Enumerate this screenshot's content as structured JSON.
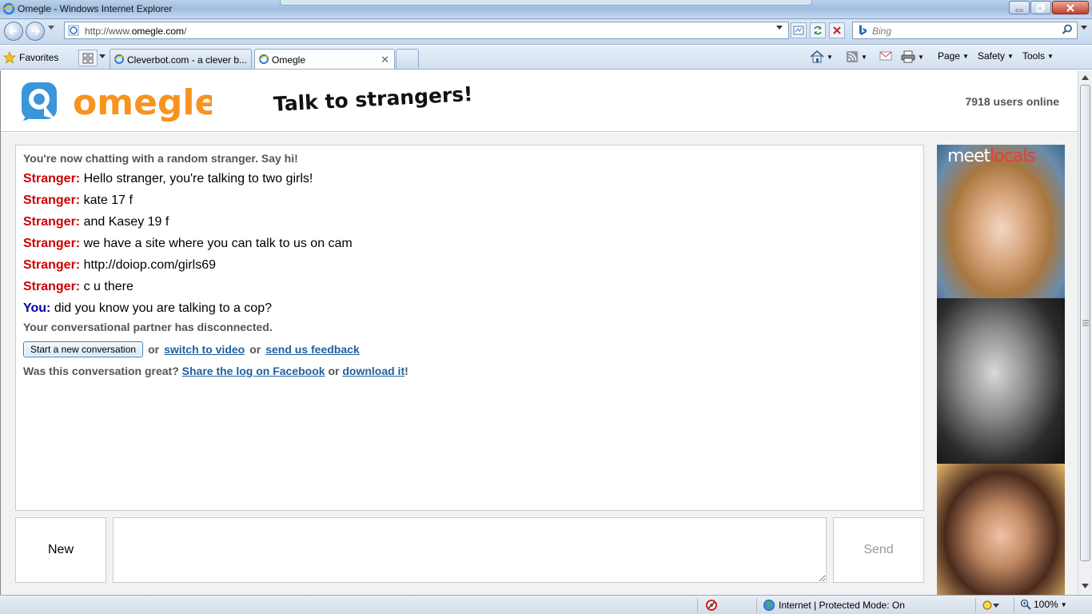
{
  "window": {
    "title": "Omegle - Windows Internet Explorer"
  },
  "address_bar": {
    "url_prefix": "http://www.",
    "url_domain": "omegle.com",
    "url_suffix": "/"
  },
  "search": {
    "placeholder": "Bing"
  },
  "favorites_bar": {
    "favorites_label": "Favorites"
  },
  "tabs": [
    {
      "label": "Cleverbot.com - a clever b...",
      "active": false
    },
    {
      "label": "Omegle",
      "active": true
    }
  ],
  "command_bar": {
    "page_label": "Page",
    "safety_label": "Safety",
    "tools_label": "Tools"
  },
  "site": {
    "logo_text": "omegle",
    "tagline": "Talk to strangers!",
    "users_online_count": "7918",
    "users_online_suffix": "users online"
  },
  "chat": {
    "intro": "You're now chatting with a random stranger. Say hi!",
    "messages": [
      {
        "who": "Stranger:",
        "text": "Hello stranger, you're talking to two girls!"
      },
      {
        "who": "Stranger:",
        "text": "kate 17 f"
      },
      {
        "who": "Stranger:",
        "text": "and Kasey 19 f"
      },
      {
        "who": "Stranger:",
        "text": "we have a site where you can talk to us on cam"
      },
      {
        "who": "Stranger:",
        "text": "http://doiop.com/girls69"
      },
      {
        "who": "Stranger:",
        "text": "c u there"
      },
      {
        "who": "You:",
        "text": "did you know you are talking to a cop?"
      }
    ],
    "disconnected": "Your conversational partner has disconnected.",
    "restart_button": "Start a new conversation",
    "or_1": "or",
    "switch_video_link": "switch to video",
    "or_2": "or",
    "feedback_link": "send us feedback",
    "great_prompt": "Was this conversation great?",
    "share_link": "Share the log on Facebook",
    "or_3": "or",
    "download_link": "download it",
    "exclaim": "!"
  },
  "controls": {
    "new_button": "New",
    "send_button": "Send",
    "message_value": ""
  },
  "ad": {
    "brand_part1": "meet",
    "brand_part2": "locals"
  },
  "status_bar": {
    "zone_text": "Internet | Protected Mode: On",
    "zoom": "100%"
  },
  "colors": {
    "stranger": "#cc0000",
    "you": "#0000aa",
    "logo_blue": "#3a95d9",
    "logo_orange": "#f7931e",
    "link": "#1f5f9f"
  }
}
